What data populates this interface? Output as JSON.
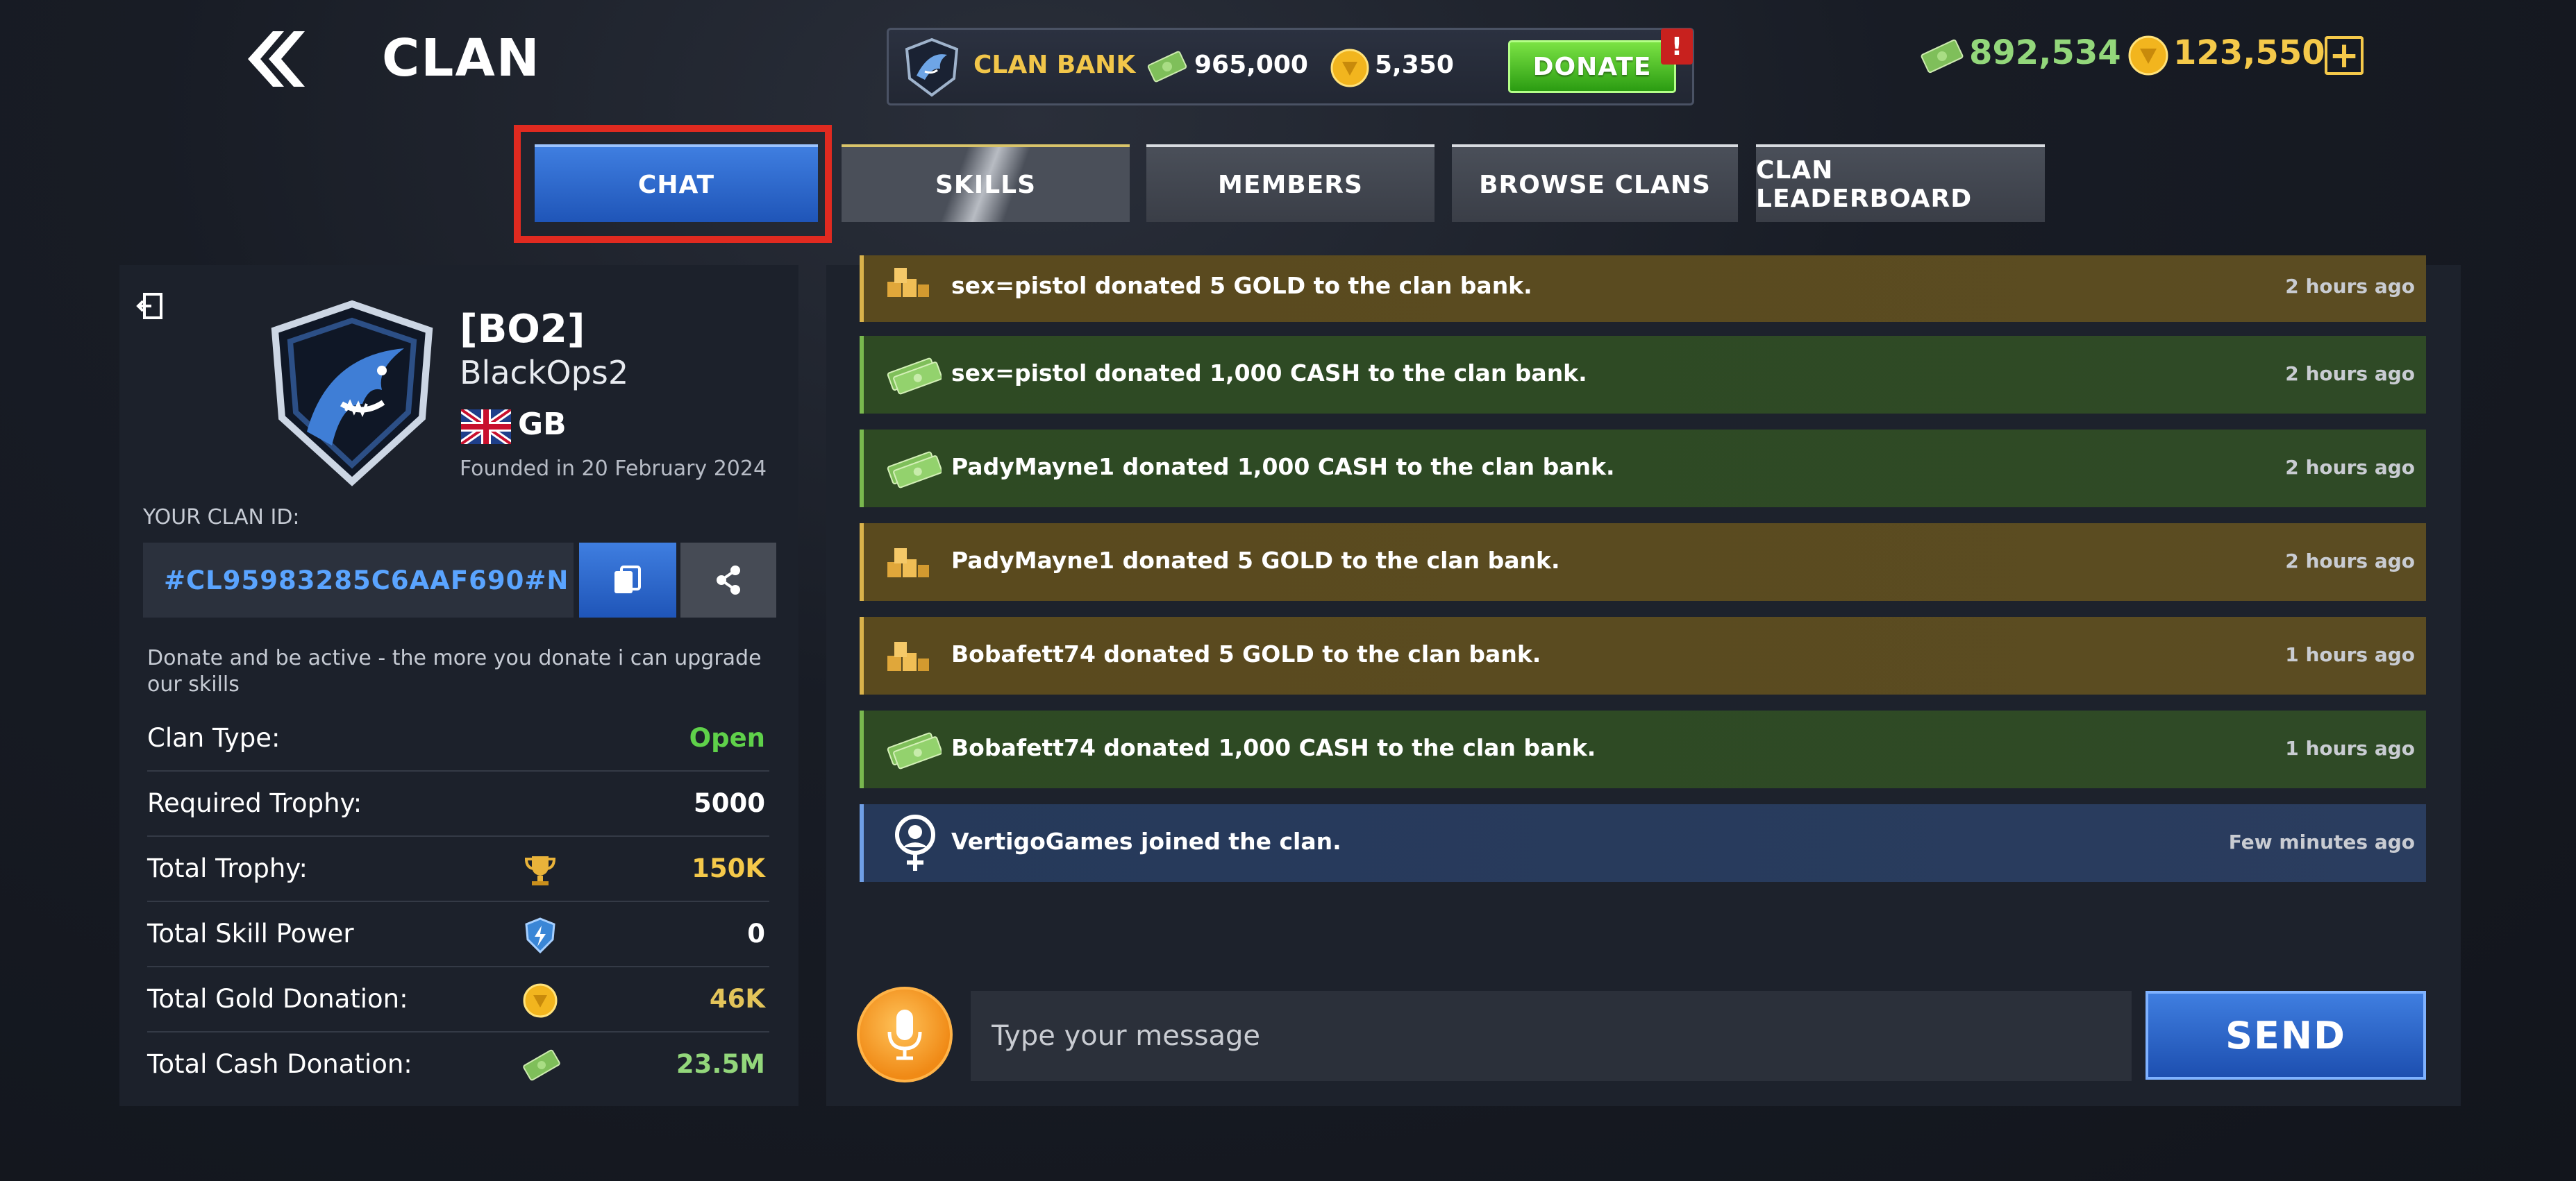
{
  "header": {
    "title": "CLAN",
    "clan_bank": {
      "label": "CLAN BANK",
      "cash": "965,000",
      "gold": "5,350",
      "donate_label": "DONATE",
      "donate_alert": "!"
    },
    "wallet": {
      "cash": "892,534",
      "gold": "123,550",
      "add_symbol": "+"
    }
  },
  "tabs": [
    {
      "label": "CHAT",
      "active": true
    },
    {
      "label": "SKILLS",
      "active": false
    },
    {
      "label": "MEMBERS",
      "active": false
    },
    {
      "label": "BROWSE CLANS",
      "active": false
    },
    {
      "label": "CLAN LEADERBOARD",
      "active": false
    }
  ],
  "clan": {
    "tag": "[BO2]",
    "name": "BlackOps2",
    "country": "GB",
    "founded": "Founded in 20 February 2024",
    "id_label": "YOUR CLAN ID:",
    "id": "#CL95983285C6AAF690#N",
    "description": "Donate and be active - the more you donate i can upgrade our skills",
    "stats": [
      {
        "label": "Clan Type:",
        "value": "Open",
        "icon": "",
        "color": "#5fd14a"
      },
      {
        "label": "Required Trophy:",
        "value": "5000",
        "icon": "",
        "color": "#ffffff"
      },
      {
        "label": "Total Trophy:",
        "value": "150K",
        "icon": "trophy-icon",
        "color": "#f5c94a"
      },
      {
        "label": "Total Skill Power",
        "value": "0",
        "icon": "skill-power-icon",
        "color": "#ffffff"
      },
      {
        "label": "Total Gold Donation:",
        "value": "46K",
        "icon": "gold-coin-icon",
        "color": "#e3c45a"
      },
      {
        "label": "Total Cash Donation:",
        "value": "23.5M",
        "icon": "cash-icon",
        "color": "#93d77b"
      }
    ]
  },
  "chat": {
    "messages": [
      {
        "type": "gold",
        "text": "sex=pistol donated 5 GOLD to the clan bank.",
        "time": "2 hours ago"
      },
      {
        "type": "cash",
        "text": "sex=pistol donated 1,000 CASH to the clan bank.",
        "time": "2 hours ago"
      },
      {
        "type": "cash",
        "text": "PadyMayne1 donated 1,000 CASH to the clan bank.",
        "time": "2 hours ago"
      },
      {
        "type": "gold",
        "text": "PadyMayne1 donated 5 GOLD to the clan bank.",
        "time": "2 hours ago"
      },
      {
        "type": "gold",
        "text": "Bobafett74 donated 5 GOLD to the clan bank.",
        "time": "1 hours ago"
      },
      {
        "type": "cash",
        "text": "Bobafett74 donated 1,000 CASH to the clan bank.",
        "time": "1 hours ago"
      },
      {
        "type": "join",
        "text": "VertigoGames joined the clan.",
        "time": "Few minutes ago"
      }
    ],
    "input_placeholder": "Type your message",
    "send_label": "SEND"
  }
}
